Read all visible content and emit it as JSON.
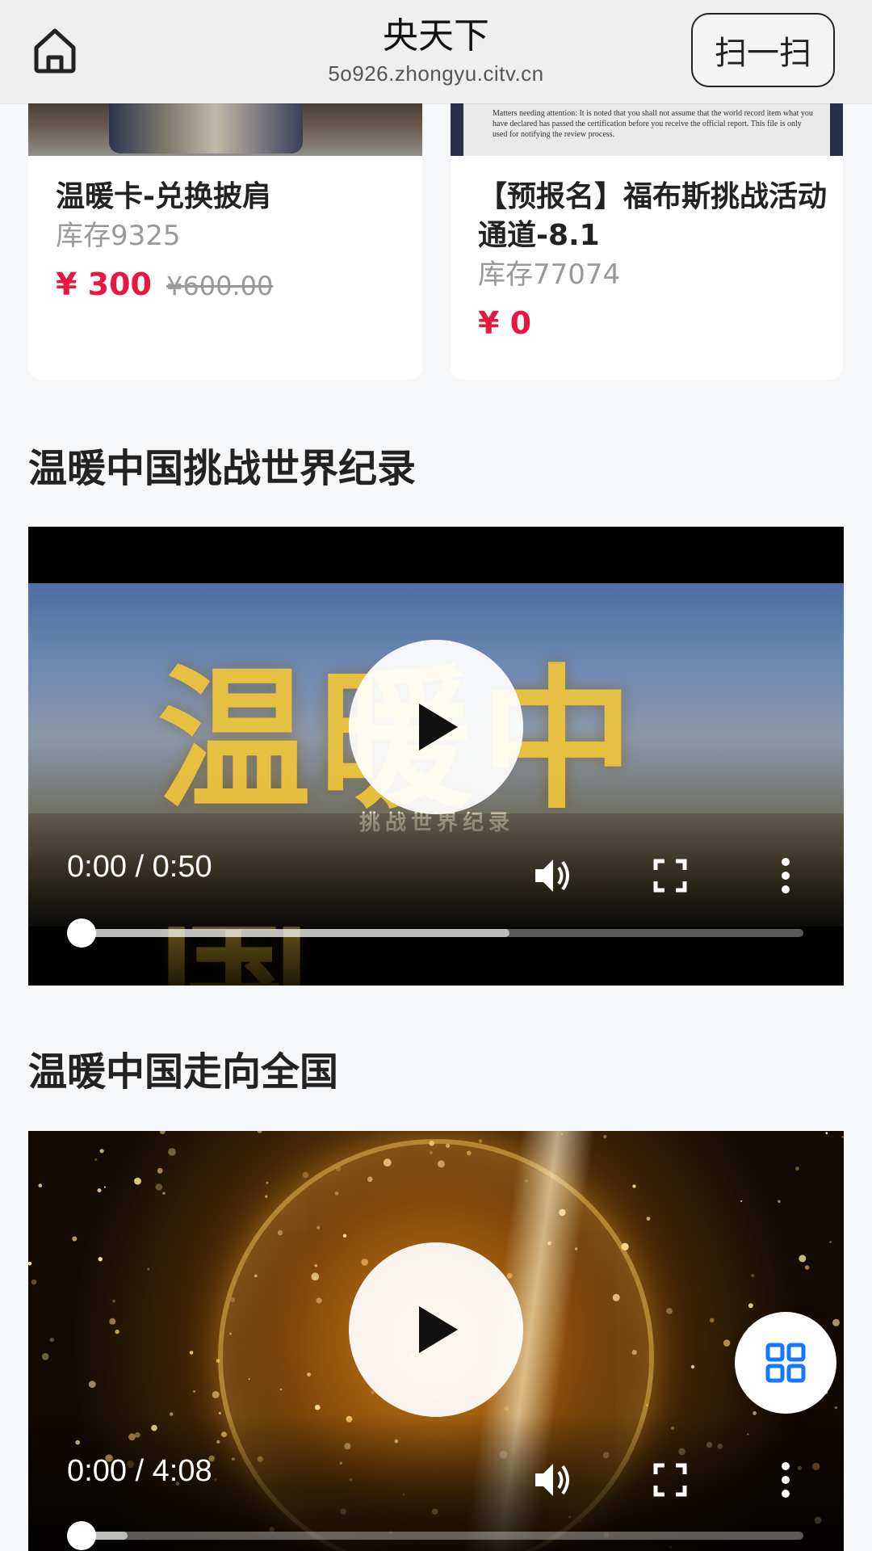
{
  "header": {
    "title": "央天下",
    "subtitle": "5o926.zhongyu.citv.cn",
    "scan_label": "扫一扫"
  },
  "products": [
    {
      "name": "温暖卡-兑换披肩",
      "stock": "库存9325",
      "price": "¥ 300",
      "original_price": "¥600.00"
    },
    {
      "name": "【预报名】福布斯挑战活动通道-8.1",
      "stock": "库存77074",
      "price": "¥ 0",
      "image_text": "Matters needing attention:\nIt is noted that you shall not assume that the world record item what you have declared has passed the certification before you receive the official report. This file is only used for notifying the review process."
    }
  ],
  "sections": [
    {
      "title": "温暖中国挑战世界纪录",
      "video": {
        "time": "0:00 / 0:50",
        "progress": 0,
        "buffered": 0.6
      }
    },
    {
      "title": "温暖中国走向全国",
      "video": {
        "time": "0:00 / 4:08",
        "progress": 0,
        "buffered": 0.08
      }
    }
  ],
  "colors": {
    "price": "#e8173f",
    "accent": "#1677ff",
    "header_bg": "#efefef",
    "page_bg": "#f6f7f9"
  },
  "icons": {
    "home": "home-icon",
    "play": "play-icon",
    "volume": "volume-icon",
    "fullscreen": "fullscreen-icon",
    "more": "more-vertical-icon",
    "grid": "grid-icon"
  }
}
